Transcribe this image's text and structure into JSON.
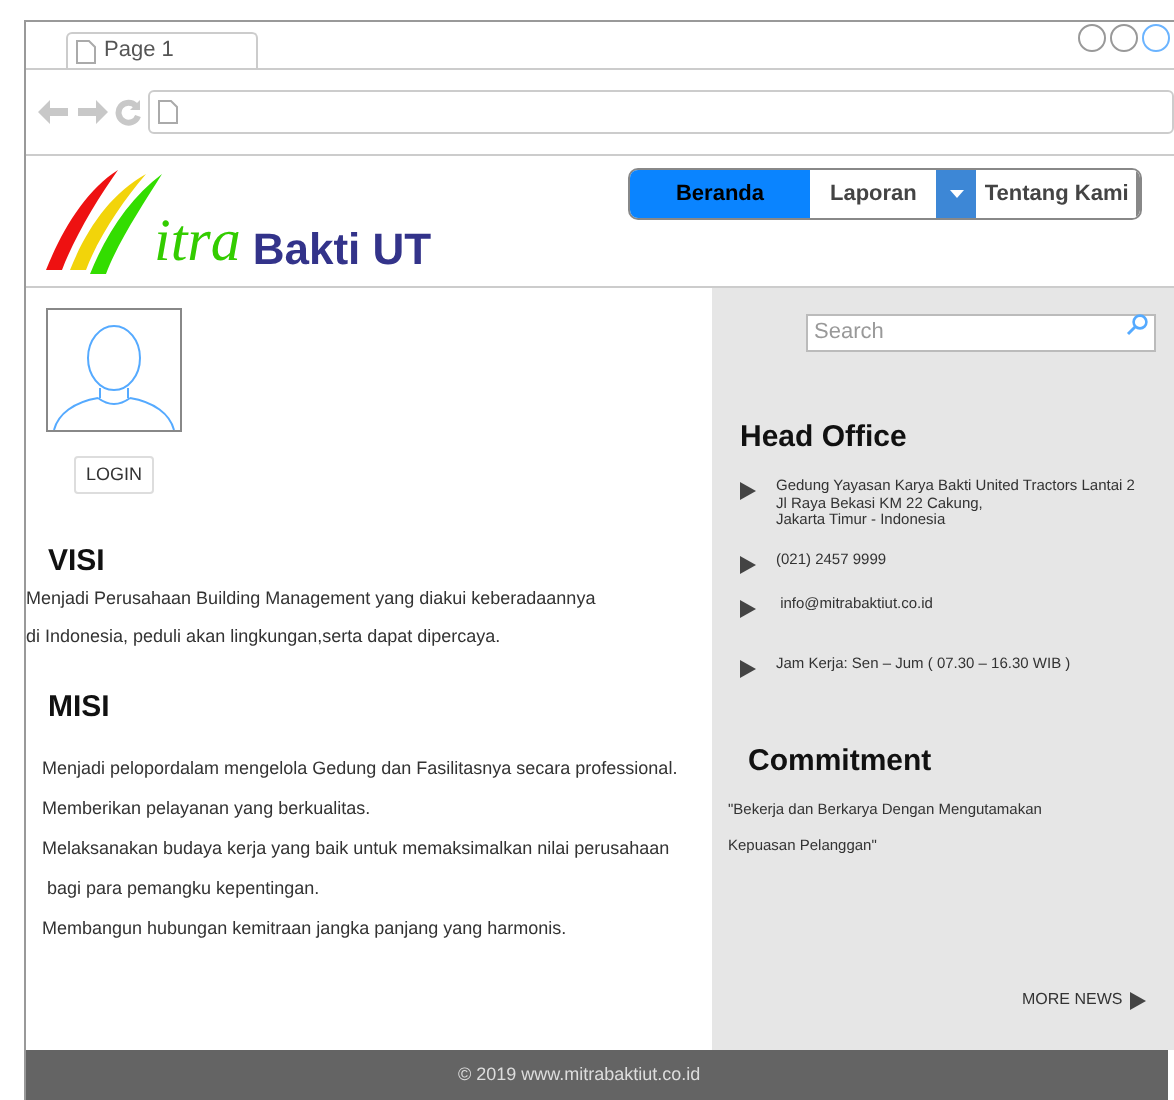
{
  "browser": {
    "tab_title": "Page 1"
  },
  "logo": {
    "script": "itra",
    "name": "Bakti UT"
  },
  "nav": [
    {
      "label": "Beranda",
      "selected": true,
      "dropdown": false
    },
    {
      "label": "Laporan",
      "selected": false,
      "dropdown": true
    },
    {
      "label": "Tentang Kami",
      "selected": false,
      "dropdown": false
    }
  ],
  "login": {
    "button": "LOGIN"
  },
  "visi": {
    "title": "VISI",
    "lines": [
      "Menjadi Perusahaan Building Management yang diakui keberadaannya",
      "di Indonesia, peduli akan lingkungan,serta dapat dipercaya."
    ]
  },
  "misi": {
    "title": "MISI",
    "lines": [
      "Menjadi pelopordalam mengelola Gedung dan Fasilitasnya secara professional.",
      "Memberikan pelayanan yang berkualitas.",
      "Melaksanakan budaya kerja yang baik untuk memaksimalkan nilai perusahaan",
      " bagi para pemangku kepentingan.",
      "Membangun hubungan kemitraan jangka panjang yang harmonis."
    ]
  },
  "search": {
    "placeholder": "Search"
  },
  "head_office": {
    "title": "Head Office",
    "items": [
      {
        "lines": [
          "Gedung Yayasan Karya Bakti United Tractors Lantai 2",
          "Jl Raya Bekasi KM 22 Cakung,",
          "Jakarta Timur - Indonesia"
        ]
      },
      {
        "lines": [
          "(021) 2457 9999"
        ]
      },
      {
        "lines": [
          " info@mitrabaktiut.co.id"
        ]
      },
      {
        "lines": [
          "Jam Kerja: Sen – Jum ( 07.30 – 16.30 WIB )"
        ]
      }
    ]
  },
  "commitment": {
    "title": "Commitment",
    "lines": [
      "\"Bekerja dan Berkarya Dengan Mengutamakan",
      "Kepuasan Pelanggan\""
    ]
  },
  "more_news": "MORE NEWS",
  "footer": "© 2019 www.mitrabaktiut.co.id"
}
